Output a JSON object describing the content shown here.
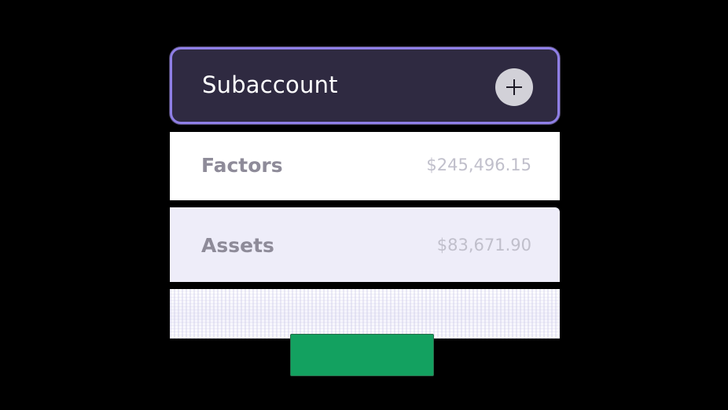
{
  "header": {
    "title": "Subaccount",
    "add_button_icon": "plus-icon"
  },
  "rows": [
    {
      "label": "Factors",
      "value": "$245,496.15"
    },
    {
      "label": "Assets",
      "value": "$83,671.90"
    }
  ],
  "colors": {
    "header_background": "#2f2a41",
    "header_border": "#8f7fe6",
    "selected_row_background": "#eeedf9",
    "green_bar": "#13a160"
  }
}
